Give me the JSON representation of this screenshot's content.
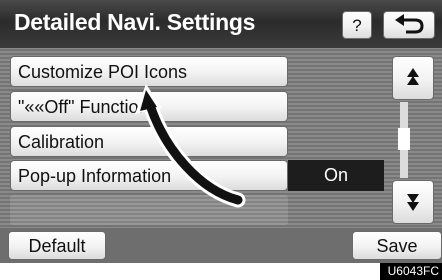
{
  "header": {
    "title": "Detailed Navi. Settings",
    "help_label": "?",
    "back_icon": "back-arrow-icon"
  },
  "list": {
    "items": [
      {
        "label": "Customize POI Icons"
      },
      {
        "label": "\"««Off\" Function"
      },
      {
        "label": "Calibration"
      },
      {
        "label": "Pop-up Information"
      }
    ],
    "popup_value": "On"
  },
  "scroll": {
    "up_icon": "scroll-up-icon",
    "down_icon": "scroll-down-icon"
  },
  "footer": {
    "default_label": "Default",
    "save_label": "Save"
  },
  "figure_code": "U6043FC"
}
